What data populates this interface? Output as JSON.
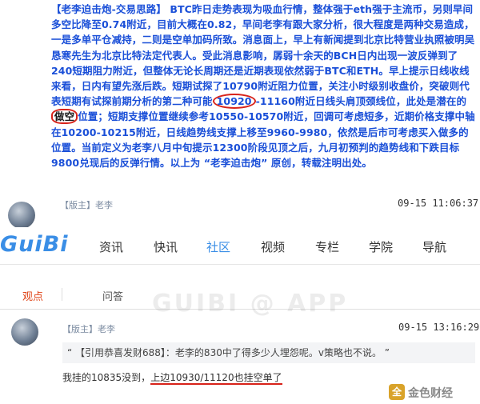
{
  "post": {
    "tag": "【老李迫击炮-交易思路】",
    "before_first": " BTC昨日走势表现为吸血行情，整体强于eth强于主流币，另则早间多空比降至0.74附近，目前大概在0.82，早间老李有跟大家分析，很大程度是两种交易造成，一是多单平仓减持，二则是空单加码所致。消息面上，早上有新闻提到北京比特营业执照被明吴恳寒先生为北京比特法定代表人。受此消息影响，孱弱十余天的BCH日内出现一波反弹到了240短期阻力附近，但整体无论长周期还是近期表现依然弱于BTC和ETH。早上提示日线收线来看，日内有望先涨后跌。短期试探了10790附近阻力位置，关注小时级别收盘价，突破则代表短期有试探前期分析的第二种可能",
    "circled_value": "10920",
    "middle": "-11160附近日线头肩顶颈线位，此处是潜在的",
    "boxed_word": "做空",
    "after": "位置；短期支撑位置继续参考10550-10570附近，回调可考虑短多，近期价格支撑中轴在10200-10215附近，日线趋势线支撑上移至9960-9980，依然是后市可考虑买入做多的位置。当前定义为老李八月中旬提示12300阶段见顶之后，九月初预判的趋势线和下跌目标9800兑现后的反弹行情。以上为 “老李迫击炮” 原创，转载注明出处。"
  },
  "post_meta": {
    "author": "【版主】老李",
    "time": "09-15 11:06:37"
  },
  "navbar": {
    "logo": "GuiBi",
    "items": [
      "资讯",
      "快讯",
      "社区",
      "视频",
      "专栏",
      "学院",
      "导航"
    ],
    "active_item": "社区"
  },
  "tabs": {
    "items": [
      "观点",
      "问答"
    ],
    "active": "观点"
  },
  "watermark": "GUIBI @ APP",
  "reply": {
    "author": "【版主】老李",
    "time": "09-15 13:16:29",
    "quote": "“ 【引用恭喜发财688】：老李的830中了得多少人埋怨呢。v策略也不说。 ”",
    "text_plain": "我挂的10835没到，",
    "text_underlined": "上边10930/11120也挂空单了"
  },
  "corner_brand": {
    "badge": "全",
    "text": "金色财经"
  },
  "colors": {
    "post_text": "#1a4fd8",
    "accent": "#3a8ee6",
    "highlight": "#d8231a",
    "tab_active": "#e0461a"
  }
}
